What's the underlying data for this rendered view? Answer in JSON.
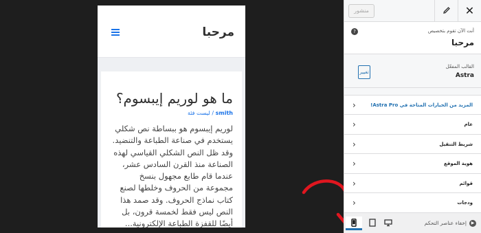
{
  "preview": {
    "site_title": "مرحبا",
    "post_title": "ما هو لوريم إيبسوم؟",
    "post_author": "smith",
    "post_category": "ليست فئة",
    "post_meta_separator": " / ",
    "post_body": "لوريم إيبسوم هو ببساطة نص شكلي يستخدم في صناعة الطباعة والتنضيد. وقد ظل النص الشكلي القياسي لهذه الصناعة منذ القرن السادس عشر، عندما قام طابع مجهول بنسخ مجموعة من الحروف وخلطها لصنع كتاب نماذج الحروف. وقد صمد هذا النص ليس فقط لخمسة قرون، بل أيضًا للقفزة الطباعة الإلكترونية..."
  },
  "panel": {
    "publish_label": "منشور",
    "close_icon": "close-icon",
    "edit_icon": "pencil-icon",
    "customizing_label": "أنت الآن تقوم بتخصيص",
    "site_name": "مرحبا",
    "theme_label": "القالب المفعّل",
    "theme_name": "Astra",
    "change_label": "تغيير",
    "pro_link": "المزيد من الخيارات المتاحة في Astra Pro!",
    "sections": [
      {
        "label": "عام"
      },
      {
        "label": "شريط التنقيل"
      },
      {
        "label": "هوية الموقع"
      },
      {
        "label": "قوائم"
      },
      {
        "label": "ودجات"
      }
    ],
    "hide_controls": "إخفاء عناصر التحكم",
    "devices": [
      "mobile-icon",
      "tablet-icon",
      "desktop-icon"
    ]
  },
  "colors": {
    "accent": "#2271b1",
    "annotation": "#e0161f"
  }
}
